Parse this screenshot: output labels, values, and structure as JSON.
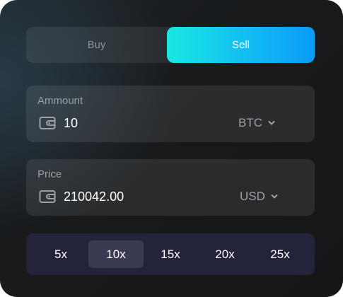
{
  "trade_side": {
    "buy_label": "Buy",
    "sell_label": "Sell",
    "selected": "Sell",
    "accent_gradient": [
      "#19e8e0",
      "#0a9bf6"
    ]
  },
  "amount": {
    "label": "Ammount",
    "icon": "wallet-icon",
    "value": "10",
    "unit": "BTC"
  },
  "price": {
    "label": "Price",
    "icon": "wallet-icon",
    "value": "210042.00",
    "unit": "USD"
  },
  "leverage": {
    "options": [
      "5x",
      "10x",
      "15x",
      "20x",
      "25x"
    ],
    "selected": "10x"
  }
}
